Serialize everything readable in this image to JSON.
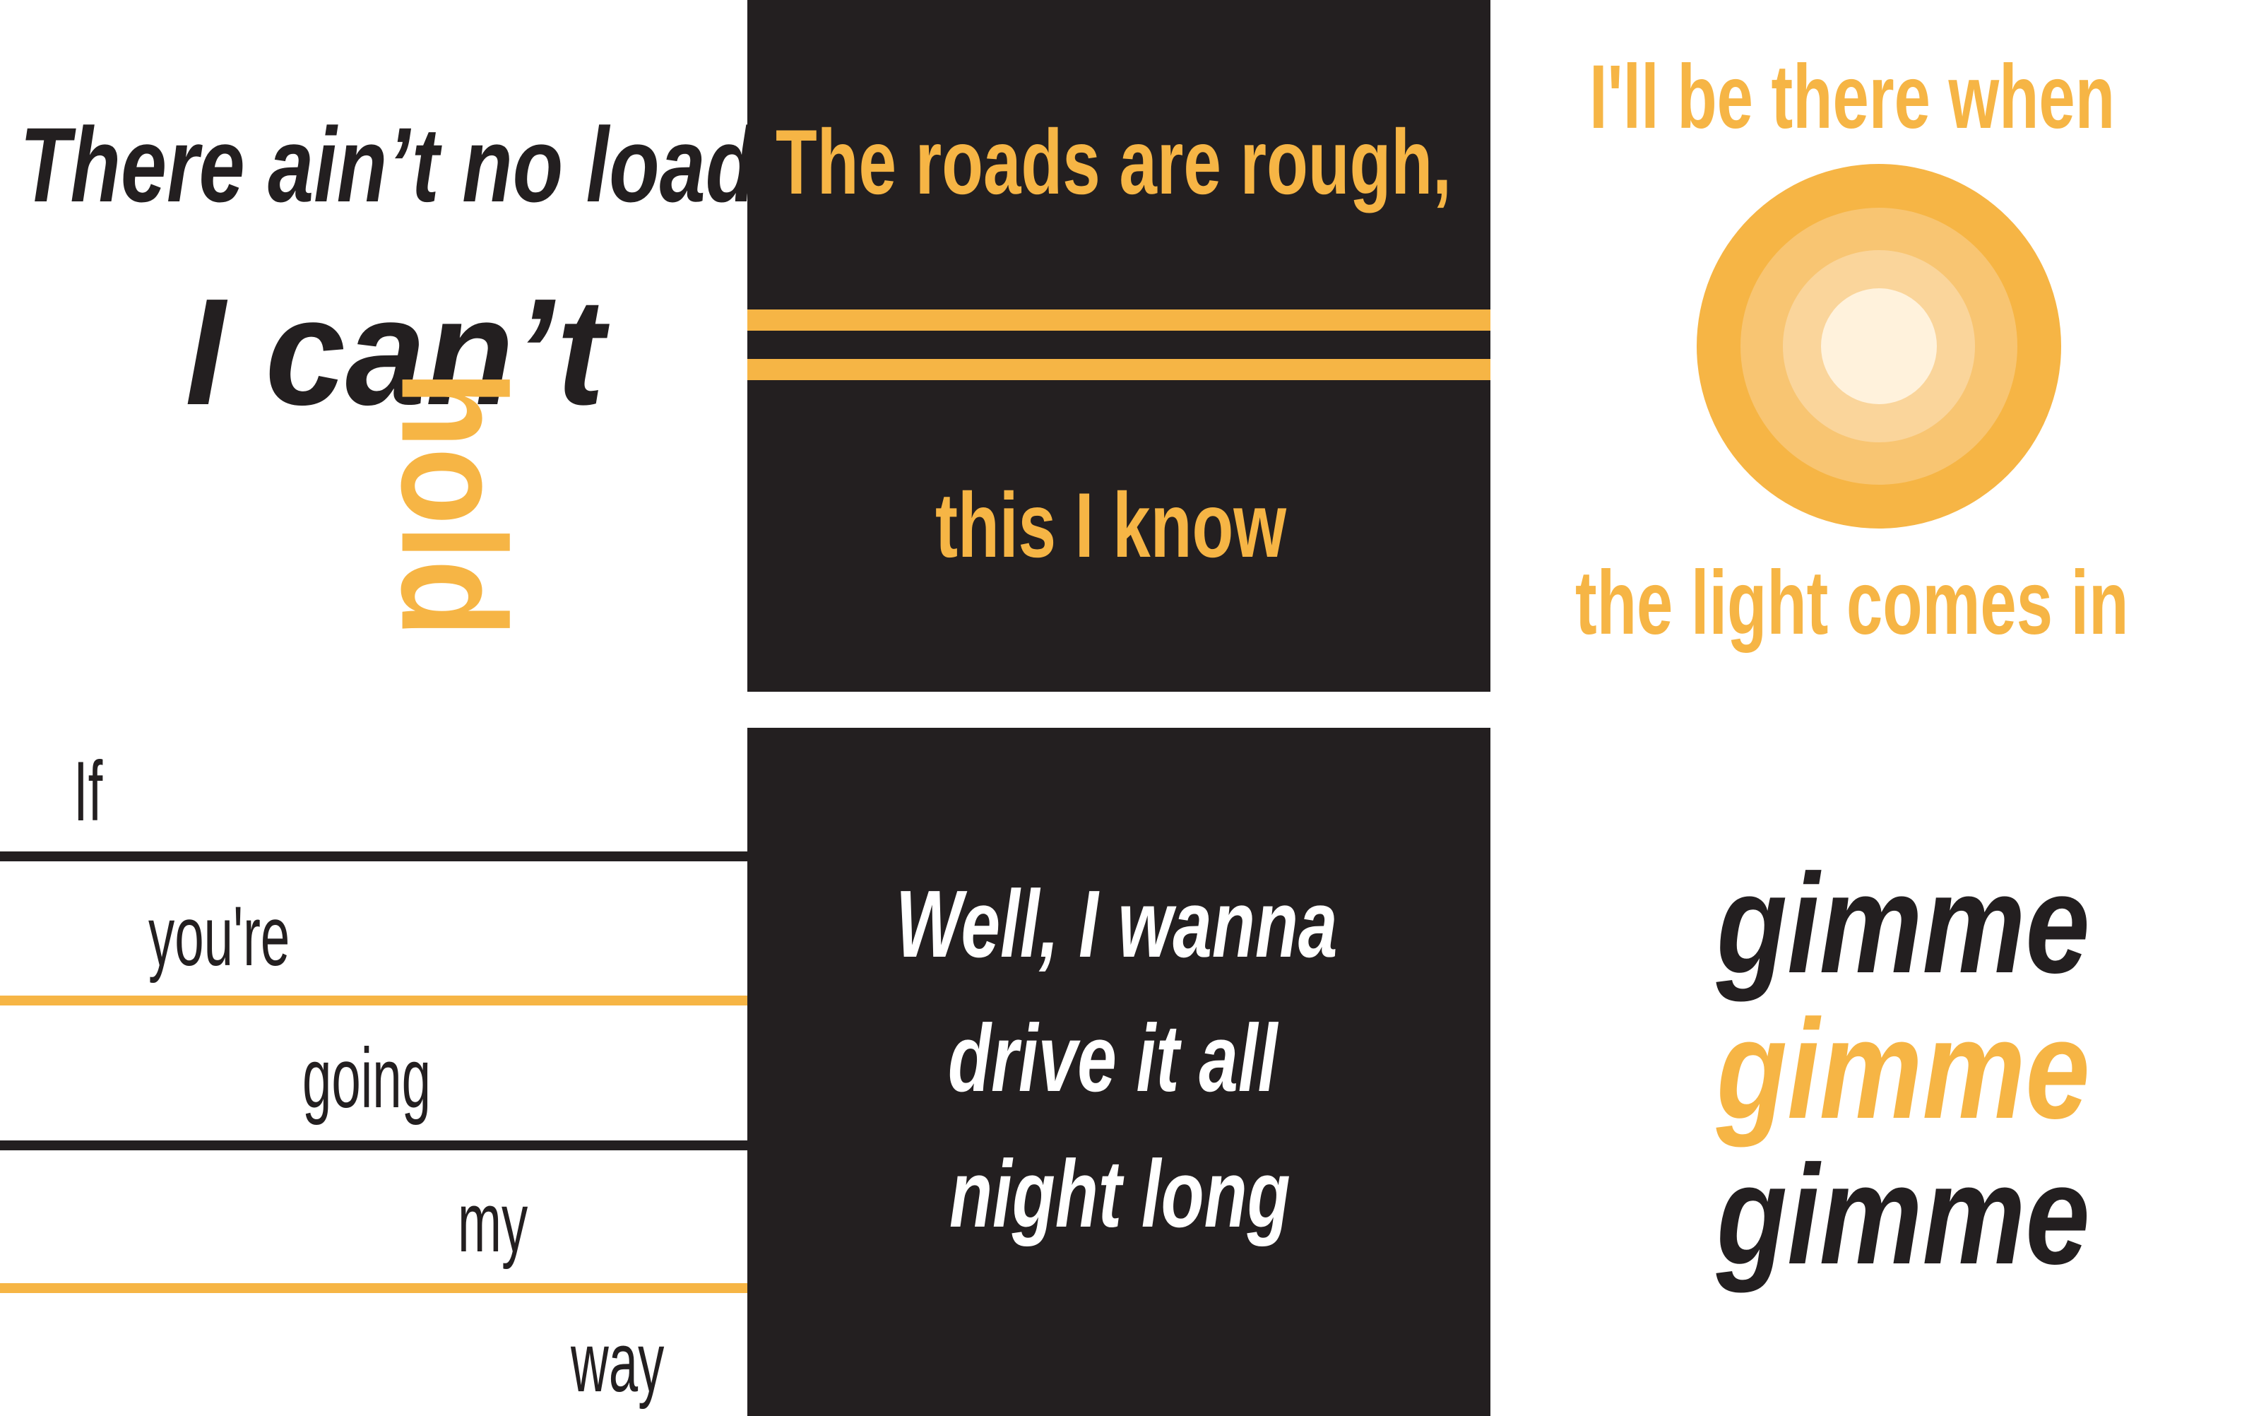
{
  "colors": {
    "black": "#231f20",
    "gold": "#f6b545",
    "white": "#ffffff",
    "ring2": "#f8c572",
    "ring3": "#fad59b",
    "ring4": "#fde6c2",
    "ring5": "#fff5e3"
  },
  "tile1": {
    "line1": "There ain’t no load",
    "line2": "I can’t",
    "line3": "hold"
  },
  "tile2": {
    "line1": "The roads are rough,",
    "line2": "this I know"
  },
  "tile3": {
    "line1": "I'll be there when",
    "line2": "the light comes in",
    "icon": "sun-rings-icon"
  },
  "tile4": {
    "words": [
      "If",
      "you're",
      "going",
      "my",
      "way"
    ]
  },
  "tile5": {
    "line1": "Well, I wanna",
    "line2": "drive it all",
    "line3": "night long"
  },
  "tile6": {
    "words": [
      "gimme",
      "gimme",
      "gimme"
    ]
  }
}
